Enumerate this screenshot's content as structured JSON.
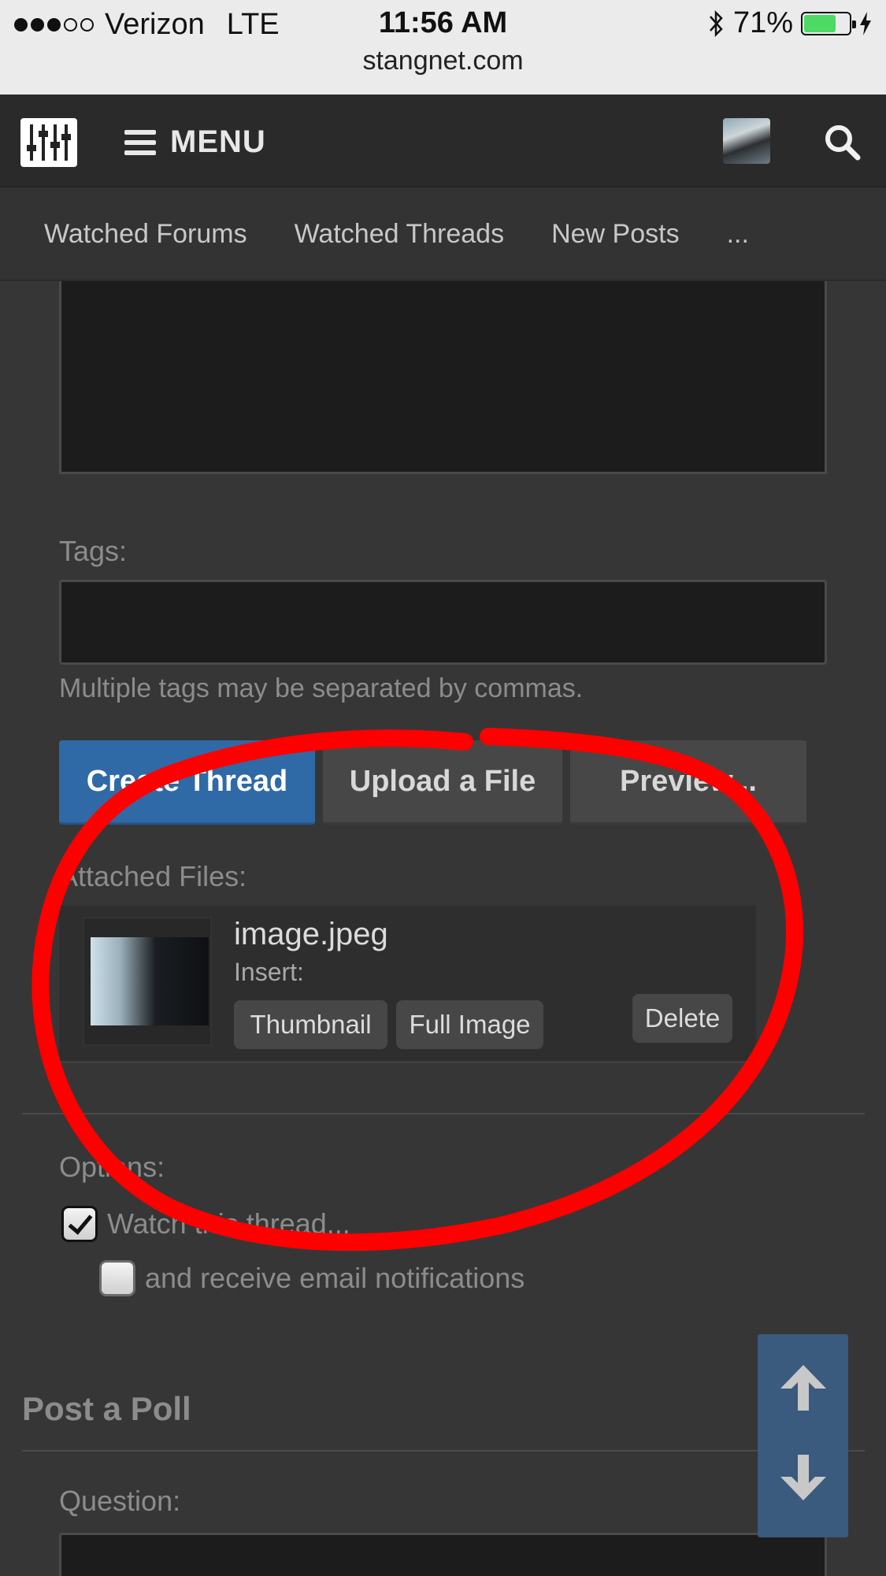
{
  "status": {
    "carrier": "Verizon",
    "network": "LTE",
    "time": "11:56 AM",
    "battery_percent_label": "71%",
    "battery_level": 0.71
  },
  "browser": {
    "url": "stangnet.com"
  },
  "header": {
    "menu_label": "MENU"
  },
  "subnav": {
    "items": [
      "Watched Forums",
      "Watched Threads",
      "New Posts",
      "..."
    ]
  },
  "form": {
    "tags_label": "Tags:",
    "tags_value": "",
    "tags_hint": "Multiple tags may be separated by commas.",
    "buttons": {
      "create": "Create Thread",
      "upload": "Upload a File",
      "preview": "Preview..."
    },
    "attached_label": "Attached Files:",
    "attachment": {
      "file_name": "image.jpeg",
      "insert_label": "Insert:",
      "thumbnail": "Thumbnail",
      "full_image": "Full Image",
      "delete": "Delete"
    },
    "options_label": "Options:",
    "watch_label": "Watch this thread...",
    "watch_checked": true,
    "email_label": "and receive email notifications",
    "email_checked": false
  },
  "poll": {
    "title": "Post a Poll",
    "question_label": "Question:",
    "question_value": ""
  },
  "colors": {
    "primary_button": "#2f6aa6",
    "annotation": "#ff0000",
    "background": "#363636"
  }
}
